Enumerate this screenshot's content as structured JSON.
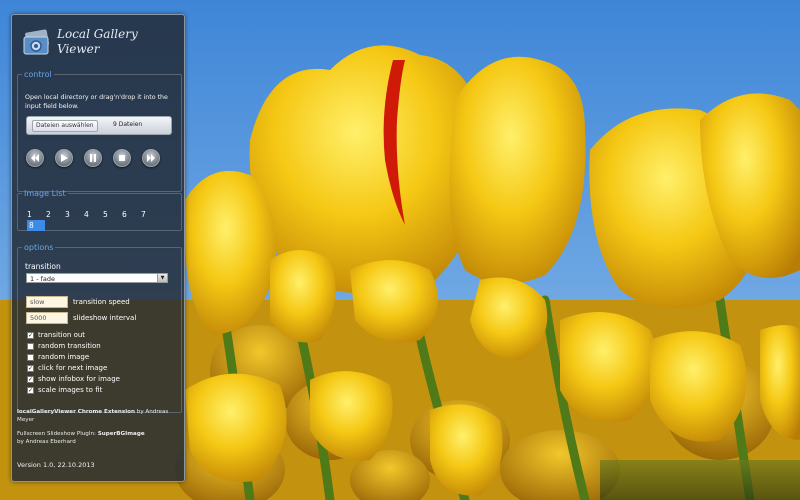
{
  "app": {
    "title_line1": "Local Gallery",
    "title_line2": "Viewer"
  },
  "control": {
    "legend": "control",
    "description": "Open local directory or drag'n'drop it into the input field below.",
    "file_button": "Dateien auswählen",
    "file_count": "9 Dateien",
    "buttons": [
      "rewind-icon",
      "play-icon",
      "pause-icon",
      "stop-icon",
      "fast-forward-icon"
    ]
  },
  "image_list": {
    "legend": "Image List",
    "numbers": [
      "1",
      "2",
      "3",
      "4",
      "5",
      "6",
      "7"
    ],
    "selected": "8"
  },
  "options": {
    "legend": "options",
    "transition_label": "transition",
    "transition_value": "1 - fade",
    "speed_value": "slow",
    "speed_label": "transition speed",
    "interval_value": "5000",
    "interval_label": "slideshow interval",
    "checkboxes": [
      {
        "label": "transition out",
        "checked": true
      },
      {
        "label": "random transition",
        "checked": false
      },
      {
        "label": "random image",
        "checked": false
      },
      {
        "label": "click for next image",
        "checked": true
      },
      {
        "label": "show infobox for image",
        "checked": true
      },
      {
        "label": "scale images to fit",
        "checked": true
      }
    ]
  },
  "credits": {
    "ext_name": "localGalleryViewer Chrome Extension",
    "ext_by": "by Andreas Meyer",
    "plugin_prefix": "Fullscreen Slideshow PlugIn:",
    "plugin_name": "SuperBGImage",
    "plugin_by": "by Andreas Eberhard"
  },
  "version": "Version 1.0, 22.10.2013",
  "colors": {
    "accent": "#6aa5ea",
    "selection": "#3d8be6",
    "panel": "#222a34"
  }
}
